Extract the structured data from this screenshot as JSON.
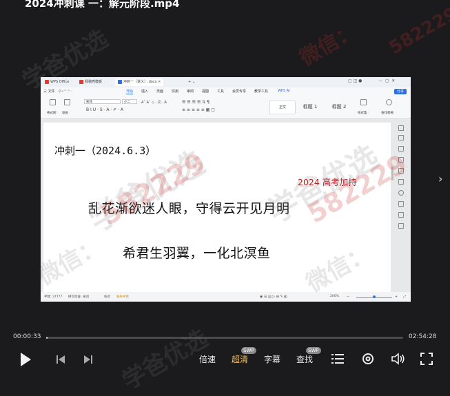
{
  "video": {
    "title": "2024冲刺课 一：解元阶段.mp4",
    "current_time": "00:00:33",
    "total_time": "02:54:28",
    "progress": 0.0032
  },
  "player_controls": {
    "speed_label": "倍速",
    "quality_label": "超清",
    "quality_badge": "SWP",
    "subtitle_label": "字幕",
    "search_label": "查找",
    "search_badge": "SWP"
  },
  "watermark": {
    "brand": "学爸优选",
    "contact": "微信：",
    "number": "582229"
  },
  "wps": {
    "tabs": [
      {
        "label": "WPS Office"
      },
      {
        "label": "我稿壳模板"
      },
      {
        "label": "冲刺一（讲义）.docx"
      }
    ],
    "menu": [
      "三 文件",
      "开始",
      "插入",
      "页面",
      "引用",
      "审阅",
      "视图",
      "工具",
      "会员专享",
      "教学工具",
      "WPS AI"
    ],
    "share_label": "分享",
    "ribbon": {
      "font_name": "宋体",
      "size": "小二",
      "format_painter": "格式刷",
      "paste": "粘贴",
      "style_normal": "正文",
      "style_h1": "标题 1",
      "style_h2": "标题 2",
      "styles_set": "样式集",
      "find_replace": "查找替换"
    },
    "document": {
      "heading": "冲刺一（2024.6.3）",
      "tagline": "2024 高考加持",
      "line1": "乱花渐欲迷人眼，守得云开见月明",
      "line2": "希君生羽翼，一化北溟鱼"
    },
    "status": {
      "word_count": "字数: 37777",
      "spell_check": "拼写检查: 关闭",
      "proofread": "校对",
      "missing_font": "缺失字体",
      "zoom": "200%"
    }
  }
}
